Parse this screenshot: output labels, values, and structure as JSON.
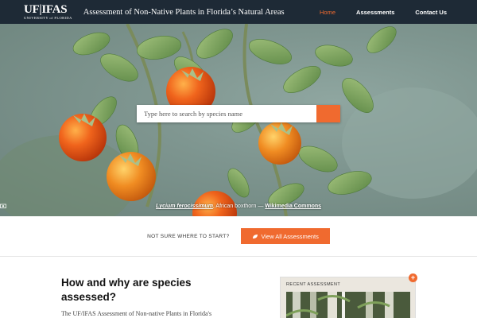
{
  "header": {
    "logo_main": "UF|IFAS",
    "logo_sub": "UNIVERSITY of FLORIDA",
    "site_title": "Assessment of Non-Native Plants in Florida’s Natural Areas",
    "nav": [
      {
        "label": "Home",
        "active": true
      },
      {
        "label": "Assessments",
        "active": false
      },
      {
        "label": "Contact Us",
        "active": false
      }
    ]
  },
  "hero": {
    "search_placeholder": "Type here to search by species name",
    "caption_species": "Lycium ferocissimum",
    "caption_common": ", African boxthorn — ",
    "caption_source": "Wikimedia Commons"
  },
  "cta": {
    "prompt": "NOT SURE WHERE TO START?",
    "button_label": "View All Assessments"
  },
  "content": {
    "heading": "How and why are species assessed?",
    "body_start": "The UF/IFAS Assessment of Non-native Plants in Florida's"
  },
  "recent": {
    "label": "RECENT ASSESSMENT",
    "add_symbol": "+"
  },
  "colors": {
    "accent": "#f06a2f",
    "header_bg": "#1e2a36"
  }
}
